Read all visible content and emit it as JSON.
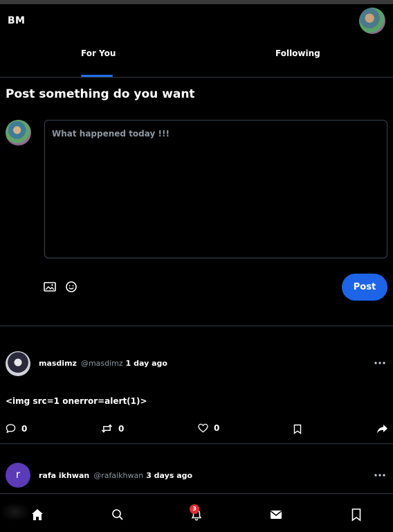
{
  "header": {
    "brand": "BM"
  },
  "tabs": [
    {
      "label": "For You",
      "active": true
    },
    {
      "label": "Following",
      "active": false
    }
  ],
  "compose": {
    "title": "Post something do you want",
    "placeholder": "What happened today !!!",
    "post_label": "Post"
  },
  "posts": [
    {
      "author": "masdimz",
      "handle": "@masdimz",
      "time": "1 day ago",
      "text": "<img src=1 onerror=alert(1)>",
      "comments": "0",
      "reposts": "0",
      "likes": "0"
    },
    {
      "author": "rafa ikhwan",
      "handle": "@rafaikhwan",
      "time": "3 days ago",
      "avatar_letter": "r"
    }
  ],
  "nav": {
    "notification_count": "3"
  },
  "colors": {
    "accent": "#1d64e8",
    "badge": "#e03131",
    "avatar_letter_bg": "#5b3bb6"
  },
  "icons": [
    "home-icon",
    "search-icon",
    "bell-icon",
    "mail-icon",
    "bookmark-icon",
    "image-icon",
    "emoji-icon",
    "comment-icon",
    "repost-icon",
    "heart-icon",
    "share-icon",
    "more-icon"
  ]
}
